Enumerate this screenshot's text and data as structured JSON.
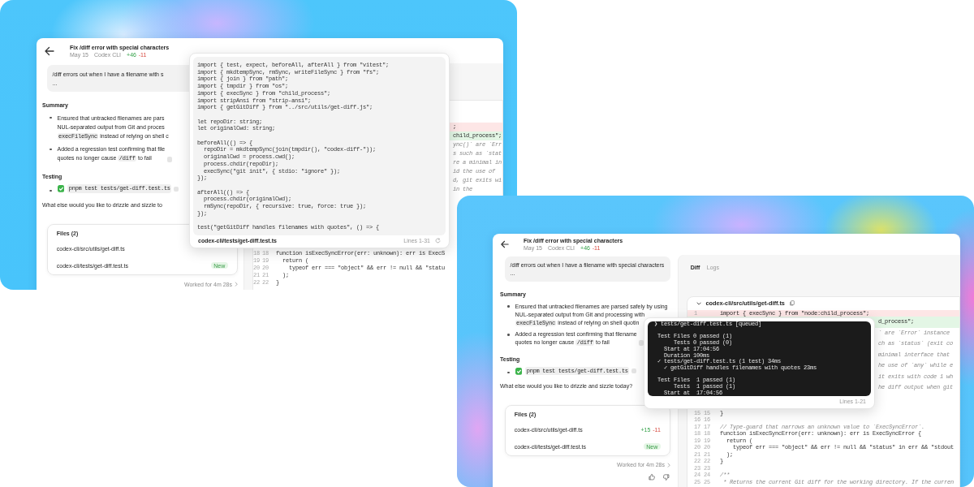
{
  "scenes": [
    {
      "header": {
        "title": "Fix /diff error with special characters",
        "date": "May 15",
        "source": "Codex CLI",
        "additions": "+46",
        "deletions": "-11"
      },
      "prompt": [
        "/diff errors out when I have a filename with s",
        "..."
      ],
      "summary": {
        "heading": "Summary",
        "bullets": [
          {
            "lines": [
              [
                {
                  "kind": "text",
                  "text": "Ensured that untracked filenames are pars"
                }
              ],
              [
                {
                  "kind": "text",
                  "text": "NUL-separated output from Git and proces"
                }
              ],
              [
                {
                  "kind": "code",
                  "text": "execFileSync"
                },
                {
                  "kind": "text",
                  "text": " instead of relying on shell c"
                }
              ]
            ],
            "cited": false
          },
          {
            "lines": [
              [
                {
                  "kind": "text",
                  "text": "Added a regression test confirming that file"
                }
              ],
              [
                {
                  "kind": "text",
                  "text": "quotes no longer cause "
                },
                {
                  "kind": "code",
                  "text": "/diff"
                },
                {
                  "kind": "text",
                  "text": " to fail"
                }
              ]
            ],
            "cited": true
          }
        ]
      },
      "testing": {
        "heading": "Testing",
        "items": [
          {
            "checked": true,
            "command": "pnpm test tests/get-diff.test.ts",
            "cited": true
          }
        ]
      },
      "question": "What else would you like to drizzle and sizzle to",
      "files": {
        "heading": "Files (2)",
        "items": [
          {
            "path": "codex-cli/src/utils/get-diff.ts"
          },
          {
            "path": "codex-cli/tests/get-diff.test.ts",
            "badge": "New"
          }
        ]
      },
      "worked": "Worked for 4m 28s",
      "feedback": false,
      "diff": {
        "rows": [
          {
            "kind": "removed",
            "text": ";"
          },
          {
            "kind": "added",
            "text": "child_process\";"
          },
          {
            "kind": "comment",
            "text": "ync()` are `Err"
          },
          {
            "kind": "comment",
            "text": "s such as `stat"
          },
          {
            "kind": "comment",
            "text": "re a minimal in"
          },
          {
            "kind": "comment",
            "text": "id the use of"
          },
          {
            "kind": "comment",
            "text": "d, git exits wi"
          },
          {
            "kind": "comment",
            "text": "in the"
          },
          {
            "kind": "context",
            "old": "18",
            "new": "18",
            "text": "function isExecSyncError(err: unknown): err is ExecS"
          },
          {
            "kind": "context",
            "old": "19",
            "new": "19",
            "text": "  return ("
          },
          {
            "kind": "context",
            "old": "20",
            "new": "20",
            "text": "    typeof err === \"object\" && err != null && \"statu"
          },
          {
            "kind": "context",
            "old": "21",
            "new": "21",
            "text": "  );"
          },
          {
            "kind": "context",
            "old": "22",
            "new": "22",
            "text": "}"
          }
        ]
      },
      "popup": {
        "kind": "code",
        "content": "import { test, expect, beforeAll, afterAll } from \"vitest\";\nimport { mkdtempSync, rmSync, writeFileSync } from \"fs\";\nimport { join } from \"path\";\nimport { tmpdir } from \"os\";\nimport { execSync } from \"child_process\";\nimport stripAnsi from \"strip-ansi\";\nimport { getGitDiff } from \"../src/utils/get-diff.js\";\n\nlet repoDir: string;\nlet originalCwd: string;\n\nbeforeAll(() => {\n  repoDir = mkdtempSync(join(tmpdir(), \"codex-diff-\"));\n  originalCwd = process.cwd();\n  process.chdir(repoDir);\n  execSync(\"git init\", { stdio: \"ignore\" });\n});\n\nafterAll(() => {\n  process.chdir(originalCwd);\n  rmSync(repoDir, { recursive: true, force: true });\n});\n\ntest(\"getGitDiff handles filenames with quotes\", () => {",
        "file": "codex-cli/tests/get-diff.test.ts",
        "range": "Lines 1-31"
      }
    },
    {
      "header": {
        "title": "Fix /diff error with special characters",
        "date": "May 15",
        "source": "Codex CLI",
        "additions": "+46",
        "deletions": "-11"
      },
      "prompt": [
        "/diff errors out when I have a filename with special characters",
        "..."
      ],
      "summary": {
        "heading": "Summary",
        "bullets": [
          {
            "lines": [
              [
                {
                  "kind": "text",
                  "text": "Ensured that untracked filenames are parsed safely by using"
                }
              ],
              [
                {
                  "kind": "text",
                  "text": "NUL-separated output from Git and processing with"
                }
              ],
              [
                {
                  "kind": "code",
                  "text": "execFileSync"
                },
                {
                  "kind": "text",
                  "text": " instead of relying on shell quotin"
                }
              ]
            ],
            "cited": false
          },
          {
            "lines": [
              [
                {
                  "kind": "text",
                  "text": "Added a regression test confirming that filename"
                }
              ],
              [
                {
                  "kind": "text",
                  "text": "quotes no longer cause "
                },
                {
                  "kind": "code",
                  "text": "/diff"
                },
                {
                  "kind": "text",
                  "text": " to fail"
                }
              ]
            ],
            "cited": true
          }
        ]
      },
      "testing": {
        "heading": "Testing",
        "items": [
          {
            "checked": true,
            "command": "pnpm test tests/get-diff.test.ts",
            "cited": true
          }
        ]
      },
      "question": "What else would you like to drizzle and sizzle today?",
      "files": {
        "heading": "Files (2)",
        "items": [
          {
            "path": "codex-cli/src/utils/get-diff.ts",
            "added": "+15",
            "removed": "-11"
          },
          {
            "path": "codex-cli/tests/get-diff.test.ts",
            "badge": "New"
          }
        ]
      },
      "worked": "Worked for 4m 28s",
      "feedback": true,
      "diff": {
        "tabs": [
          {
            "label": "Diff",
            "selected": true
          },
          {
            "label": "Logs",
            "selected": false
          }
        ],
        "file": {
          "path": "codex-cli/src/utils/get-diff.ts",
          "expanded": true
        },
        "rows": [
          {
            "kind": "removed",
            "old": "1",
            "text": "import { execSync } from \"node:child_process\";"
          },
          {
            "kind": "added",
            "text": "d_process\";"
          },
          {
            "kind": "comment",
            "text": "` are `Error` instance"
          },
          {
            "kind": "comment",
            "text": "ch as `status` (exit co"
          },
          {
            "kind": "comment",
            "text": "minimal interface that"
          },
          {
            "kind": "comment",
            "text": "he use of `any` while e"
          },
          {
            "kind": "comment",
            "text": "it exits with code 1 wh"
          },
          {
            "kind": "comment",
            "text": "he diff output when git"
          },
          {
            "kind": "context",
            "old": "15",
            "new": "15",
            "text": "}"
          },
          {
            "kind": "context",
            "old": "16",
            "new": "16"
          },
          {
            "kind": "comment",
            "old": "17",
            "new": "17",
            "text": "// Type-guard that narrows an unknown value to `ExecSyncError`."
          },
          {
            "kind": "context",
            "old": "18",
            "new": "18",
            "text": "function isExecSyncError(err: unknown): err is ExecSyncError {"
          },
          {
            "kind": "context",
            "old": "19",
            "new": "19",
            "text": "  return ("
          },
          {
            "kind": "context",
            "old": "20",
            "new": "20",
            "text": "    typeof err === \"object\" && err != null && \"status\" in err && \"stdout"
          },
          {
            "kind": "context",
            "old": "21",
            "new": "21",
            "text": "  );"
          },
          {
            "kind": "context",
            "old": "22",
            "new": "22",
            "text": "}"
          },
          {
            "kind": "context",
            "old": "23",
            "new": "23"
          },
          {
            "kind": "comment",
            "old": "24",
            "new": "24",
            "text": "/**"
          },
          {
            "kind": "comment",
            "old": "25",
            "new": "25",
            "text": " * Returns the current Git diff for the working directory. If the curren"
          }
        ]
      },
      "popup": {
        "kind": "terminal",
        "content": "❯ tests/get-diff.test.ts [queued]\n\n Test Files 0 passed (1)\n      Tests 0 passed (0)\n   Start at 17:04:56\n   Duration 100ms\n ✓ tests/get-diff.test.ts (1 test) 34ms\n   ✓ getGitDiff handles filenames with quotes 23ms\n\n Test Files  1 passed (1)\n      Tests  1 passed (1)\n   Start at  17:04:56",
        "range": "Lines 1-21"
      }
    }
  ]
}
